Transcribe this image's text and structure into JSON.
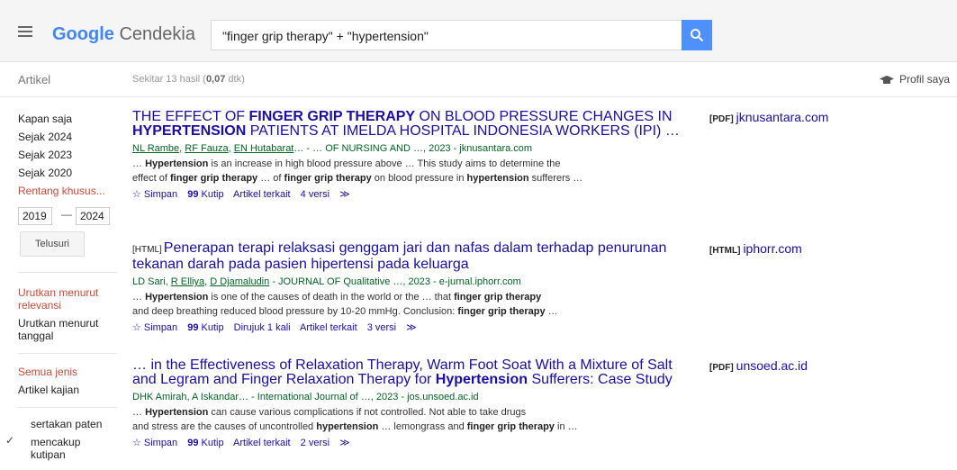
{
  "header": {
    "logo_google": "Google",
    "logo_product": "Cendekia",
    "search_query": "\"finger grip therapy\" + \"hypertension\""
  },
  "subbar": {
    "section": "Artikel",
    "results_prefix": "Sekitar 13 hasil (",
    "results_time": "0,07",
    "results_suffix": " dtk)",
    "profile": "Profil saya"
  },
  "sidebar": {
    "time_filters": [
      "Kapan saja",
      "Sejak 2024",
      "Sejak 2023",
      "Sejak 2020",
      "Rentang khusus..."
    ],
    "year_from": "2019",
    "year_dash": "—",
    "year_to": "2024",
    "search_button": "Telusuri",
    "sort_relevance": "Urutkan menurut relevansi",
    "sort_date": "Urutkan menurut tanggal",
    "type_all": "Semua jenis",
    "type_review": "Artikel kajian",
    "include_patents": "sertakan paten",
    "include_citations": "mencakup kutipan"
  },
  "results": [
    {
      "tag": "",
      "title_parts": [
        "THE EFFECT OF ",
        "FINGER GRIP THERAPY",
        " ON BLOOD PRESSURE CHANGES IN ",
        "HYPERTENSION",
        " PATIENTS AT IMELDA HOSPITAL INDONESIA WORKERS (IPI) …"
      ],
      "authors": [
        "NL Rambe",
        "RF Fauza",
        "EN Hutabarat"
      ],
      "source": "… - … OF NURSING AND …, 2023 - jknusantara.com",
      "snippet_1": [
        "… ",
        "Hypertension",
        " is an increase in high blood pressure above … This study aims to determine the"
      ],
      "snippet_2": [
        "effect of ",
        "finger grip therapy",
        " … of ",
        "finger grip therapy",
        " on blood pressure in ",
        "hypertension",
        " sufferers …"
      ],
      "links": [
        "Simpan",
        "Kutip",
        "Artikel terkait",
        "4 versi"
      ],
      "side_type": "[PDF]",
      "side_domain": "jknusantara.com"
    },
    {
      "tag": "[HTML]",
      "title_parts": [
        "Penerapan terapi relaksasi genggam jari dan nafas dalam terhadap penurunan tekanan darah pada pasien hipertensi pada keluarga"
      ],
      "authors": [
        "LD Sari",
        "R Elliya",
        "D Djamaludin"
      ],
      "source": "- JOURNAL OF Qualitative …, 2023 - e-jurnal.iphorr.com",
      "snippet_1": [
        "… ",
        "Hypertension",
        " is one of the causes of death in the world or the … that ",
        "finger grip therapy"
      ],
      "snippet_2": [
        "and deep breathing reduced blood pressure by 10-20 mmHg. Conclusion: ",
        "finger grip therapy",
        " …"
      ],
      "links": [
        "Simpan",
        "Kutip",
        "Dirujuk 1 kali",
        "Artikel terkait",
        "3 versi"
      ],
      "side_type": "[HTML]",
      "side_domain": "iphorr.com"
    },
    {
      "tag": "",
      "title_parts": [
        "… in the Effectiveness of Relaxation Therapy, Warm Foot Soat With a Mixture of Salt and Legram and Finger Relaxation Therapy for ",
        "Hypertension",
        " Sufferers: Case Study"
      ],
      "authors_plain": "DHK Amirah, A Iskandar… - International Journal of …, 2023 - jos.unsoed.ac.id",
      "snippet_1": [
        "… ",
        "Hypertension",
        " can cause various complications if not controlled. Not able to take drugs"
      ],
      "snippet_2": [
        "and stress are the causes of uncontrolled ",
        "hypertension",
        " … lemongrass and ",
        "finger grip therapy",
        " in …"
      ],
      "links": [
        "Simpan",
        "Kutip",
        "Artikel terkait",
        "2 versi"
      ],
      "side_type": "[PDF]",
      "side_domain": "unsoed.ac.id"
    }
  ],
  "icons": {
    "star": "☆",
    "quote": "99",
    "more": "≫"
  }
}
